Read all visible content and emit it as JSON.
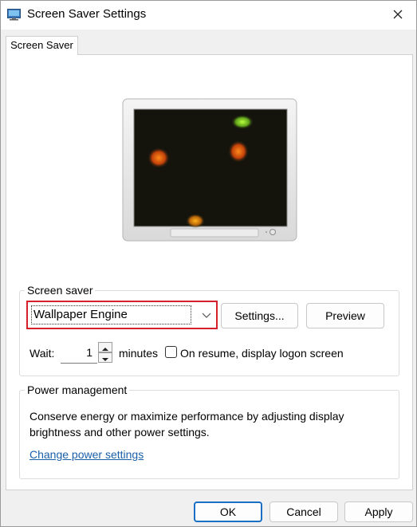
{
  "window": {
    "title": "Screen Saver Settings",
    "app_icon": "display-settings-icon",
    "close_icon": "close-icon"
  },
  "tab": {
    "label": "Screen Saver"
  },
  "screen_saver_group": {
    "label": "Screen saver",
    "selected": "Wallpaper Engine",
    "settings_label": "Settings...",
    "preview_label": "Preview",
    "wait_label": "Wait:",
    "wait_value": "1",
    "minutes_label": "minutes",
    "resume_label": "On resume, display logon screen",
    "resume_checked": false
  },
  "power_group": {
    "label": "Power management",
    "description": "Conserve energy or maximize performance by adjusting display brightness and other power settings.",
    "link": "Change power settings"
  },
  "footer": {
    "ok_label": "OK",
    "cancel_label": "Cancel",
    "apply_label": "Apply"
  },
  "colors": {
    "highlight": "#d6202a",
    "link": "#1a5fa8",
    "ok_border": "#1a6fc4"
  }
}
